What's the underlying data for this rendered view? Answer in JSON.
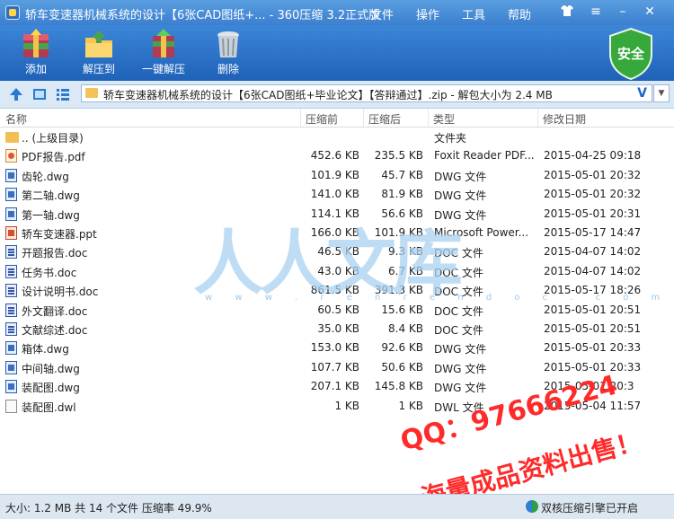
{
  "window": {
    "title": "轿车变速器机械系统的设计【6张CAD图纸+... - 360压缩 3.2正式版",
    "menu": [
      "文件",
      "操作",
      "工具",
      "帮助"
    ]
  },
  "toolbar": {
    "add": "添加",
    "extract_to": "解压到",
    "one_click": "一键解压",
    "delete": "删除",
    "security_badge": "安全"
  },
  "address": {
    "path": "轿车变速器机械系统的设计【6张CAD图纸+毕业论文】【答辩通过】.zip - 解包大小为 2.4 MB"
  },
  "columns": {
    "name": "名称",
    "size": "压缩前",
    "packed": "压缩后",
    "type": "类型",
    "modified": "修改日期"
  },
  "files": [
    {
      "name": ".. (上级目录)",
      "size": "",
      "packed": "",
      "type": "文件夹",
      "date": "",
      "icon": "folder"
    },
    {
      "name": "PDF报告.pdf",
      "size": "452.6 KB",
      "packed": "235.5 KB",
      "type": "Foxit Reader PDF...",
      "date": "2015-04-25 09:18",
      "icon": "pdf"
    },
    {
      "name": "齿轮.dwg",
      "size": "101.9 KB",
      "packed": "45.7 KB",
      "type": "DWG 文件",
      "date": "2015-05-01 20:32",
      "icon": "dwg"
    },
    {
      "name": "第二轴.dwg",
      "size": "141.0 KB",
      "packed": "81.9 KB",
      "type": "DWG 文件",
      "date": "2015-05-01 20:32",
      "icon": "dwg"
    },
    {
      "name": "第一轴.dwg",
      "size": "114.1 KB",
      "packed": "56.6 KB",
      "type": "DWG 文件",
      "date": "2015-05-01 20:31",
      "icon": "dwg"
    },
    {
      "name": "轿车变速器.ppt",
      "size": "166.0 KB",
      "packed": "101.9 KB",
      "type": "Microsoft Power...",
      "date": "2015-05-17 14:47",
      "icon": "ppt"
    },
    {
      "name": "开题报告.doc",
      "size": "46.5 KB",
      "packed": "9.3 KB",
      "type": "DOC 文件",
      "date": "2015-04-07 14:02",
      "icon": "doc"
    },
    {
      "name": "任务书.doc",
      "size": "43.0 KB",
      "packed": "6.7 KB",
      "type": "DOC 文件",
      "date": "2015-04-07 14:02",
      "icon": "doc"
    },
    {
      "name": "设计说明书.doc",
      "size": "861.5 KB",
      "packed": "391.3 KB",
      "type": "DOC 文件",
      "date": "2015-05-17 18:26",
      "icon": "doc"
    },
    {
      "name": "外文翻译.doc",
      "size": "60.5 KB",
      "packed": "15.6 KB",
      "type": "DOC 文件",
      "date": "2015-05-01 20:51",
      "icon": "doc"
    },
    {
      "name": "文献综述.doc",
      "size": "35.0 KB",
      "packed": "8.4 KB",
      "type": "DOC 文件",
      "date": "2015-05-01 20:51",
      "icon": "doc"
    },
    {
      "name": "箱体.dwg",
      "size": "153.0 KB",
      "packed": "92.6 KB",
      "type": "DWG 文件",
      "date": "2015-05-01 20:33",
      "icon": "dwg"
    },
    {
      "name": "中间轴.dwg",
      "size": "107.7 KB",
      "packed": "50.6 KB",
      "type": "DWG 文件",
      "date": "2015-05-01 20:33",
      "icon": "dwg"
    },
    {
      "name": "装配图.dwg",
      "size": "207.1 KB",
      "packed": "145.8 KB",
      "type": "DWG 文件",
      "date": "2015-05-01 20:3",
      "icon": "dwg"
    },
    {
      "name": "装配图.dwl",
      "size": "1 KB",
      "packed": "1 KB",
      "type": "DWL 文件",
      "date": "2015-05-04 11:57",
      "icon": "dwl"
    }
  ],
  "watermark": {
    "text": "人人文库",
    "url": "w w w . r e n r e n d o c . c o m"
  },
  "stamp": {
    "line1": "QQ：97666224",
    "line2": "海量成品资料出售！"
  },
  "status": {
    "left": "大小: 1.2 MB 共 14 个文件 压缩率 49.9%",
    "right": "双核压缩引擎已开启"
  },
  "colors": {
    "accent": "#1f62b8",
    "stamp_red": "#ff2a2a",
    "shield_green": "#37a83c"
  }
}
